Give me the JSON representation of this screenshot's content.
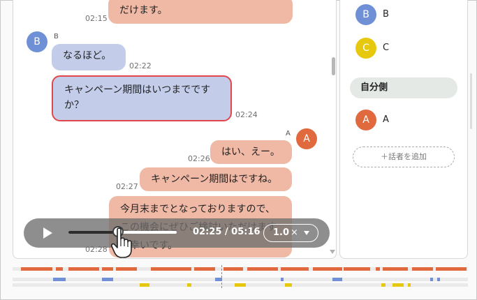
{
  "colors": {
    "speaker_a": "#e06a3d",
    "speaker_b": "#6f8fd6",
    "speaker_c": "#e6c90f",
    "highlight_border": "#e0464a"
  },
  "messages": [
    {
      "speaker": "A",
      "text": "だけます。",
      "time": "02:15"
    },
    {
      "speaker": "B",
      "speaker_label": "B",
      "text": "なるほど。",
      "time": "02:22"
    },
    {
      "speaker": "B",
      "text": "キャンペーン期間はいつまでですか？",
      "time": "02:24"
    },
    {
      "speaker": "A",
      "speaker_label": "A",
      "text": "はい、えー。",
      "time": "02:26"
    },
    {
      "speaker": "A",
      "text": "キャンペーン期間はですね。",
      "time": "02:27"
    },
    {
      "speaker": "A",
      "text": "今月末までとなっておりますので、この機会にぜひご検討いただけますと幸いです。",
      "time": "02:28"
    }
  ],
  "player": {
    "current": "02:25",
    "total": "05:16",
    "time_text": "02:25 / 05:16",
    "progress": 0.459,
    "speed": "1.0",
    "speed_unit": "×"
  },
  "sidebar": {
    "other_speakers": [
      {
        "initial": "B",
        "name": "B"
      },
      {
        "initial": "C",
        "name": "C"
      }
    ],
    "own_section_title": "自分側",
    "own_speakers": [
      {
        "initial": "A",
        "name": "A"
      }
    ],
    "add_label": "＋話者を追加"
  },
  "timeline": {
    "cursor_position": 0.459
  }
}
